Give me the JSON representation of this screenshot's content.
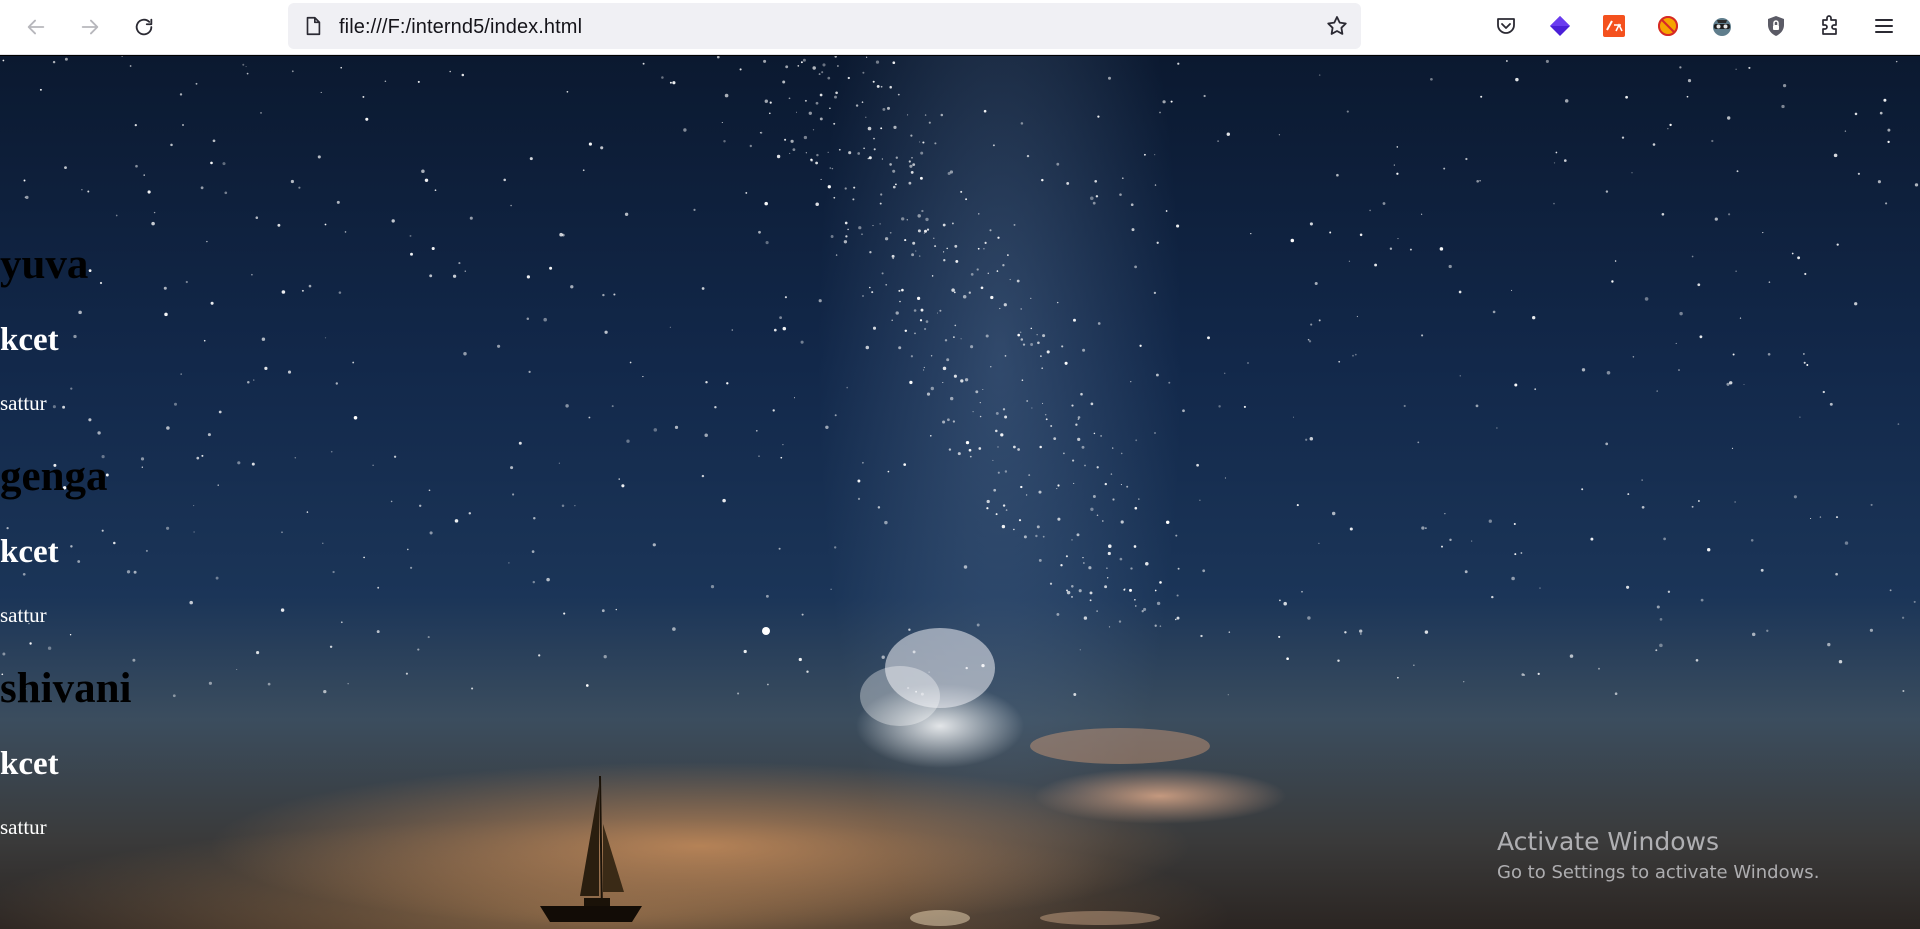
{
  "browser": {
    "url": "file:///F:/internd5/index.html",
    "icons": {
      "back": "arrow-left-icon",
      "forward": "arrow-right-icon",
      "reload": "reload-icon",
      "page": "document-icon",
      "bookmark": "star-icon",
      "pocket": "pocket-icon",
      "extension1": "purple-diamond-icon",
      "extension2": "orange-translate-icon",
      "extension3": "no-ads-icon",
      "extension4": "spy-icon",
      "extension5": "shield-lock-icon",
      "extensions": "puzzle-icon",
      "menu": "hamburger-menu-icon"
    }
  },
  "page": {
    "entries": [
      {
        "name": "yuva",
        "college": "kcet",
        "place": "sattur"
      },
      {
        "name": "genga",
        "college": "kcet",
        "place": "sattur"
      },
      {
        "name": "shivani",
        "college": "kcet",
        "place": "sattur"
      }
    ]
  },
  "watermark": {
    "title": "Activate Windows",
    "subtitle": "Go to Settings to activate Windows."
  },
  "colors": {
    "toolbar_bg": "#ffffff",
    "urlbar_bg": "#f0f0f4",
    "heading_name": "#000000",
    "heading_college": "#ffffff",
    "text_place": "#ffffff"
  }
}
